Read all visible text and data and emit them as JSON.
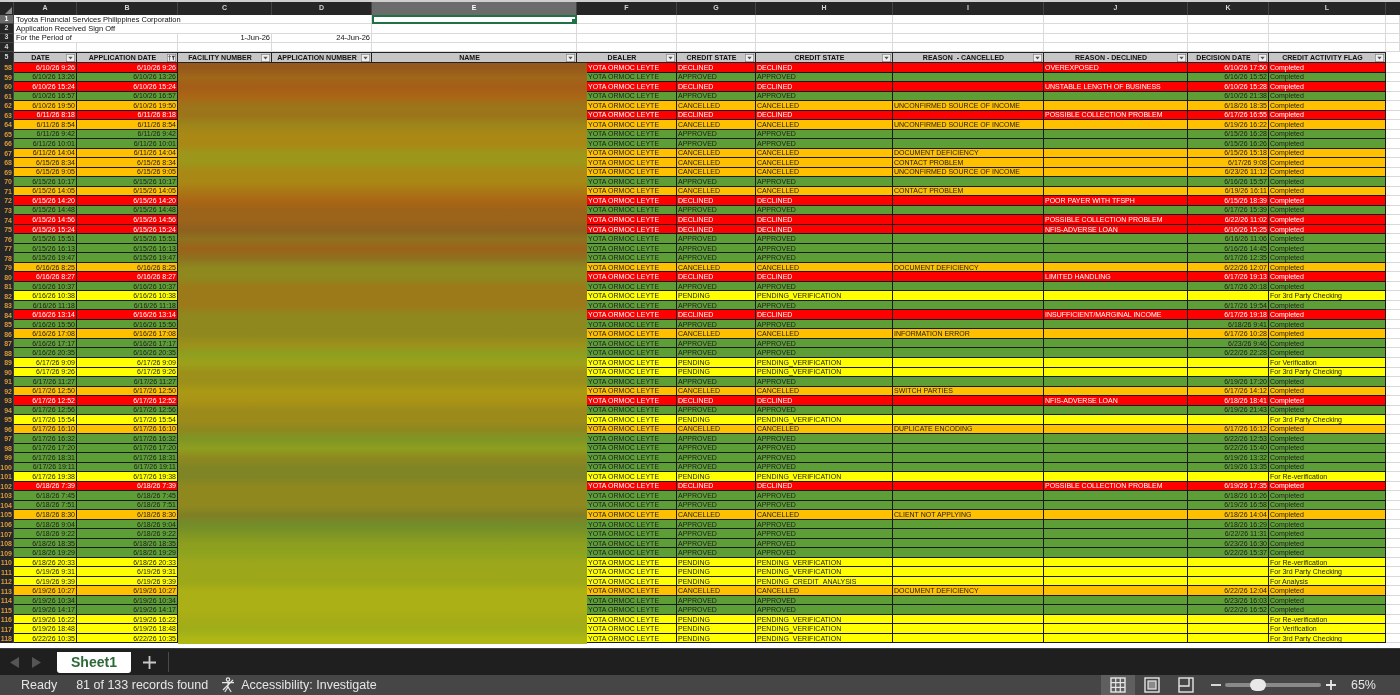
{
  "sheet": {
    "column_letters": [
      {
        "letter": "A",
        "selected": false
      },
      {
        "letter": "B",
        "selected": false
      },
      {
        "letter": "C",
        "selected": false
      },
      {
        "letter": "D",
        "selected": false
      },
      {
        "letter": "E",
        "selected": true
      },
      {
        "letter": "F",
        "selected": false
      },
      {
        "letter": "G",
        "selected": false
      },
      {
        "letter": "H",
        "selected": false
      },
      {
        "letter": "I",
        "selected": false
      },
      {
        "letter": "J",
        "selected": false
      },
      {
        "letter": "K",
        "selected": false
      },
      {
        "letter": "L",
        "selected": false
      }
    ],
    "title_rows": [
      {
        "row_number": "1",
        "selected": true,
        "a": "Toyota Financial Services Philippines Corporation"
      },
      {
        "row_number": "2",
        "selected": false,
        "a": "Application Received Sign Off"
      },
      {
        "row_number": "3",
        "selected": false,
        "a": "For the Period of",
        "c": "1-Jun-26",
        "d": "24-Jun-26"
      },
      {
        "row_number": "4",
        "selected": false
      }
    ],
    "header_row": {
      "row_number": "5",
      "columns": [
        {
          "label": "DATE",
          "kind": "dropdown"
        },
        {
          "label": "APPLICATION DATE",
          "kind": "sort_filter"
        },
        {
          "label": "FACILITY NUMBER",
          "kind": "dropdown"
        },
        {
          "label": "APPLICATION NUMBER",
          "kind": "dropdown"
        },
        {
          "label": "NAME",
          "kind": "dropdown"
        },
        {
          "label": "DEALER",
          "kind": "dropdown"
        },
        {
          "label": "CREDIT STATE",
          "kind": "dropdown"
        },
        {
          "label": "CREDIT STATE",
          "kind": "dropdown"
        },
        {
          "label": "REASON  - CANCELLED",
          "kind": "dropdown"
        },
        {
          "label": "REASON - DECLINED",
          "kind": "dropdown"
        },
        {
          "label": "DECISION DATE",
          "kind": "dropdown"
        },
        {
          "label": "CREDIT ACTIVITY FLAG",
          "kind": "dropdown"
        }
      ]
    },
    "rows": [
      {
        "row_number": "58",
        "date": "6/10/26 9:26",
        "application_date": "6/10/26 9:26",
        "dealer": "YOTA ORMOC LEYTE",
        "credit_state": "DECLINED",
        "credit_state_detail": "DECLINED",
        "reason_declined": "OVEREXPOSED",
        "decision_date": "6/10/26 17:50",
        "credit_activity_flag": "Completed",
        "color": "#ff0000"
      },
      {
        "row_number": "59",
        "date": "6/10/26 13:26",
        "application_date": "6/10/26 13:26",
        "dealer": "YOTA ORMOC LEYTE",
        "credit_state": "APPROVED",
        "credit_state_detail": "APPROVED",
        "decision_date": "6/16/26 15:52",
        "credit_activity_flag": "Completed",
        "color": "#5e9e37"
      },
      {
        "row_number": "60",
        "date": "6/10/26 15:24",
        "application_date": "6/10/26 15:24",
        "dealer": "YOTA ORMOC LEYTE",
        "credit_state": "DECLINED",
        "credit_state_detail": "DECLINED",
        "reason_declined": "UNSTABLE LENGTH OF BUSINESS",
        "decision_date": "6/10/26 15:28",
        "credit_activity_flag": "Completed",
        "color": "#ff0000"
      },
      {
        "row_number": "61",
        "date": "6/10/26 16:57",
        "application_date": "6/10/26 16:57",
        "dealer": "YOTA ORMOC LEYTE",
        "credit_state": "APPROVED",
        "credit_state_detail": "APPROVED",
        "decision_date": "6/10/26 21:38",
        "credit_activity_flag": "Completed",
        "color": "#5e9e37"
      },
      {
        "row_number": "62",
        "date": "6/10/26 19:50",
        "application_date": "6/10/26 19:50",
        "dealer": "YOTA ORMOC LEYTE",
        "credit_state": "CANCELLED",
        "credit_state_detail": "CANCELLED",
        "reason_cancelled": "UNCONFIRMED SOURCE OF INCOME",
        "decision_date": "6/18/26 18:35",
        "credit_activity_flag": "Completed",
        "color": "#ffc000"
      },
      {
        "row_number": "63",
        "date": "6/11/26 8:18",
        "application_date": "6/11/26 8:18",
        "dealer": "YOTA ORMOC LEYTE",
        "credit_state": "DECLINED",
        "credit_state_detail": "DECLINED",
        "reason_declined": "POSSIBLE COLLECTION PROBLEM",
        "decision_date": "6/17/26 16:55",
        "credit_activity_flag": "Completed",
        "color": "#ff0000"
      },
      {
        "row_number": "64",
        "date": "6/11/26 8:54",
        "application_date": "6/11/26 8:54",
        "dealer": "YOTA ORMOC LEYTE",
        "credit_state": "CANCELLED",
        "credit_state_detail": "CANCELLED",
        "reason_cancelled": "UNCONFIRMED SOURCE OF INCOME",
        "decision_date": "6/19/26 16:22",
        "credit_activity_flag": "Completed",
        "color": "#ffc000"
      },
      {
        "row_number": "65",
        "date": "6/11/26 9:42",
        "application_date": "6/11/26 9:42",
        "dealer": "YOTA ORMOC LEYTE",
        "credit_state": "APPROVED",
        "credit_state_detail": "APPROVED",
        "decision_date": "6/15/26 16:28",
        "credit_activity_flag": "Completed",
        "color": "#5e9e37"
      },
      {
        "row_number": "66",
        "date": "6/11/26 10:01",
        "application_date": "6/11/26 10:01",
        "dealer": "YOTA ORMOC LEYTE",
        "credit_state": "APPROVED",
        "credit_state_detail": "APPROVED",
        "decision_date": "6/15/26 16:26",
        "credit_activity_flag": "Completed",
        "color": "#5e9e37"
      },
      {
        "row_number": "67",
        "date": "6/11/26 14:04",
        "application_date": "6/11/26 14:04",
        "dealer": "YOTA ORMOC LEYTE",
        "credit_state": "CANCELLED",
        "credit_state_detail": "CANCELLED",
        "reason_cancelled": "DOCUMENT DEFICIENCY",
        "decision_date": "6/15/26 15:18",
        "credit_activity_flag": "Completed",
        "color": "#ffc000"
      },
      {
        "row_number": "68",
        "date": "6/15/26 8:34",
        "application_date": "6/15/26 8:34",
        "dealer": "YOTA ORMOC LEYTE",
        "credit_state": "CANCELLED",
        "credit_state_detail": "CANCELLED",
        "reason_cancelled": "CONTACT PROBLEM",
        "decision_date": "6/17/26 9:08",
        "credit_activity_flag": "Completed",
        "color": "#ffc000"
      },
      {
        "row_number": "69",
        "date": "6/15/26 9:05",
        "application_date": "6/15/26 9:05",
        "dealer": "YOTA ORMOC LEYTE",
        "credit_state": "CANCELLED",
        "credit_state_detail": "CANCELLED",
        "reason_cancelled": "UNCONFIRMED SOURCE OF INCOME",
        "decision_date": "6/23/26 11:12",
        "credit_activity_flag": "Completed",
        "color": "#ffc000"
      },
      {
        "row_number": "70",
        "date": "6/15/26 10:17",
        "application_date": "6/15/26 10:17",
        "dealer": "YOTA ORMOC LEYTE",
        "credit_state": "APPROVED",
        "credit_state_detail": "APPROVED",
        "decision_date": "6/16/26 15:57",
        "credit_activity_flag": "Completed",
        "color": "#5e9e37"
      },
      {
        "row_number": "71",
        "date": "6/15/26 14:05",
        "application_date": "6/15/26 14:05",
        "dealer": "YOTA ORMOC LEYTE",
        "credit_state": "CANCELLED",
        "credit_state_detail": "CANCELLED",
        "reason_cancelled": "CONTACT PROBLEM",
        "decision_date": "6/19/26 16:11",
        "credit_activity_flag": "Completed",
        "color": "#ffc000"
      },
      {
        "row_number": "72",
        "date": "6/15/26 14:20",
        "application_date": "6/15/26 14:20",
        "dealer": "YOTA ORMOC LEYTE",
        "credit_state": "DECLINED",
        "credit_state_detail": "DECLINED",
        "reason_declined": "POOR PAYER WITH TFSPH",
        "decision_date": "6/15/26 18:39",
        "credit_activity_flag": "Completed",
        "color": "#ff0000"
      },
      {
        "row_number": "73",
        "date": "6/15/26 14:48",
        "application_date": "6/15/26 14:48",
        "dealer": "YOTA ORMOC LEYTE",
        "credit_state": "APPROVED",
        "credit_state_detail": "APPROVED",
        "decision_date": "6/17/26 15:39",
        "credit_activity_flag": "Completed",
        "color": "#5e9e37"
      },
      {
        "row_number": "74",
        "date": "6/15/26 14:56",
        "application_date": "6/15/26 14:56",
        "dealer": "YOTA ORMOC LEYTE",
        "credit_state": "DECLINED",
        "credit_state_detail": "DECLINED",
        "reason_declined": "POSSIBLE COLLECTION PROBLEM",
        "decision_date": "6/22/26 11:02",
        "credit_activity_flag": "Completed",
        "color": "#ff0000"
      },
      {
        "row_number": "75",
        "date": "6/15/26 15:24",
        "application_date": "6/15/26 15:24",
        "dealer": "YOTA ORMOC LEYTE",
        "credit_state": "DECLINED",
        "credit_state_detail": "DECLINED",
        "reason_declined": "NFIS-ADVERSE LOAN",
        "decision_date": "6/16/26 15:25",
        "credit_activity_flag": "Completed",
        "color": "#ff0000"
      },
      {
        "row_number": "76",
        "date": "6/15/26 15:51",
        "application_date": "6/15/26 15:51",
        "dealer": "YOTA ORMOC LEYTE",
        "credit_state": "APPROVED",
        "credit_state_detail": "APPROVED",
        "decision_date": "6/16/26 11:06",
        "credit_activity_flag": "Completed",
        "color": "#5e9e37"
      },
      {
        "row_number": "77",
        "date": "6/15/26 16:13",
        "application_date": "6/15/26 16:13",
        "dealer": "YOTA ORMOC LEYTE",
        "credit_state": "APPROVED",
        "credit_state_detail": "APPROVED",
        "decision_date": "6/16/26 14:45",
        "credit_activity_flag": "Completed",
        "color": "#5e9e37"
      },
      {
        "row_number": "78",
        "date": "6/15/26 19:47",
        "application_date": "6/15/26 19:47",
        "dealer": "YOTA ORMOC LEYTE",
        "credit_state": "APPROVED",
        "credit_state_detail": "APPROVED",
        "decision_date": "6/17/26 12:35",
        "credit_activity_flag": "Completed",
        "color": "#5e9e37"
      },
      {
        "row_number": "79",
        "date": "6/16/26 8:25",
        "application_date": "6/16/26 8:25",
        "dealer": "YOTA ORMOC LEYTE",
        "credit_state": "CANCELLED",
        "credit_state_detail": "CANCELLED",
        "reason_cancelled": "DOCUMENT DEFICIENCY",
        "decision_date": "6/22/26 12:07",
        "credit_activity_flag": "Completed",
        "color": "#ffc000"
      },
      {
        "row_number": "80",
        "date": "6/16/26 8:27",
        "application_date": "6/16/26 8:27",
        "dealer": "YOTA ORMOC LEYTE",
        "credit_state": "DECLINED",
        "credit_state_detail": "DECLINED",
        "reason_declined": "LIMITED HANDLING",
        "decision_date": "6/17/26 19:13",
        "credit_activity_flag": "Completed",
        "color": "#ff0000"
      },
      {
        "row_number": "81",
        "date": "6/16/26 10:37",
        "application_date": "6/16/26 10:37",
        "dealer": "YOTA ORMOC LEYTE",
        "credit_state": "APPROVED",
        "credit_state_detail": "APPROVED",
        "decision_date": "6/17/26 20:18",
        "credit_activity_flag": "Completed",
        "color": "#5e9e37"
      },
      {
        "row_number": "82",
        "date": "6/16/26 10:38",
        "application_date": "6/16/26 10:38",
        "dealer": "YOTA ORMOC LEYTE",
        "credit_state": "PENDING",
        "credit_state_detail": "PENDING_VERIFICATION",
        "credit_activity_flag": "For 3rd Party Checking",
        "color": "#ffff00"
      },
      {
        "row_number": "83",
        "date": "6/16/26 11:18",
        "application_date": "6/16/26 11:18",
        "dealer": "YOTA ORMOC LEYTE",
        "credit_state": "APPROVED",
        "credit_state_detail": "APPROVED",
        "decision_date": "6/17/26 19:54",
        "credit_activity_flag": "Completed",
        "color": "#5e9e37"
      },
      {
        "row_number": "84",
        "date": "6/16/26 13:14",
        "application_date": "6/16/26 13:14",
        "dealer": "YOTA ORMOC LEYTE",
        "credit_state": "DECLINED",
        "credit_state_detail": "DECLINED",
        "reason_declined": "INSUFFICIENT/MARGINAL INCOME",
        "decision_date": "6/17/26 19:18",
        "credit_activity_flag": "Completed",
        "color": "#ff0000"
      },
      {
        "row_number": "85",
        "date": "6/16/26 15:50",
        "application_date": "6/16/26 15:50",
        "dealer": "YOTA ORMOC LEYTE",
        "credit_state": "APPROVED",
        "credit_state_detail": "APPROVED",
        "decision_date": "6/18/26 9:41",
        "credit_activity_flag": "Completed",
        "color": "#5e9e37"
      },
      {
        "row_number": "86",
        "date": "6/16/26 17:08",
        "application_date": "6/16/26 17:08",
        "dealer": "YOTA ORMOC LEYTE",
        "credit_state": "CANCELLED",
        "credit_state_detail": "CANCELLED",
        "reason_cancelled": "INFORMATION ERROR",
        "decision_date": "6/17/26 10:28",
        "credit_activity_flag": "Completed",
        "color": "#ffc000"
      },
      {
        "row_number": "87",
        "date": "6/16/26 17:17",
        "application_date": "6/16/26 17:17",
        "dealer": "YOTA ORMOC LEYTE",
        "credit_state": "APPROVED",
        "credit_state_detail": "APPROVED",
        "decision_date": "6/23/26 9:46",
        "credit_activity_flag": "Completed",
        "color": "#5e9e37"
      },
      {
        "row_number": "88",
        "date": "6/16/26 20:35",
        "application_date": "6/16/26 20:35",
        "dealer": "YOTA ORMOC LEYTE",
        "credit_state": "APPROVED",
        "credit_state_detail": "APPROVED",
        "decision_date": "6/22/26 22:28",
        "credit_activity_flag": "Completed",
        "color": "#5e9e37"
      },
      {
        "row_number": "89",
        "date": "6/17/26 9:09",
        "application_date": "6/17/26 9:09",
        "dealer": "YOTA ORMOC LEYTE",
        "credit_state": "PENDING",
        "credit_state_detail": "PENDING_VERIFICATION",
        "credit_activity_flag": "For Verification",
        "color": "#ffff00"
      },
      {
        "row_number": "90",
        "date": "6/17/26 9:26",
        "application_date": "6/17/26 9:26",
        "dealer": "YOTA ORMOC LEYTE",
        "credit_state": "PENDING",
        "credit_state_detail": "PENDING_VERIFICATION",
        "credit_activity_flag": "For 3rd Party Checking",
        "color": "#ffff00"
      },
      {
        "row_number": "91",
        "date": "6/17/26 11:27",
        "application_date": "6/17/26 11:27",
        "dealer": "YOTA ORMOC LEYTE",
        "credit_state": "APPROVED",
        "credit_state_detail": "APPROVED",
        "decision_date": "6/19/26 17:20",
        "credit_activity_flag": "Completed",
        "color": "#5e9e37"
      },
      {
        "row_number": "92",
        "date": "6/17/26 12:50",
        "application_date": "6/17/26 12:50",
        "dealer": "YOTA ORMOC LEYTE",
        "credit_state": "CANCELLED",
        "credit_state_detail": "CANCELLED",
        "reason_cancelled": "SWITCH PARTIES",
        "decision_date": "6/17/26 14:12",
        "credit_activity_flag": "Completed",
        "color": "#ffc000"
      },
      {
        "row_number": "93",
        "date": "6/17/26 12:52",
        "application_date": "6/17/26 12:52",
        "dealer": "YOTA ORMOC LEYTE",
        "credit_state": "DECLINED",
        "credit_state_detail": "DECLINED",
        "reason_declined": "NFIS-ADVERSE LOAN",
        "decision_date": "6/18/26 18:41",
        "credit_activity_flag": "Completed",
        "color": "#ff0000"
      },
      {
        "row_number": "94",
        "date": "6/17/26 12:56",
        "application_date": "6/17/26 12:56",
        "dealer": "YOTA ORMOC LEYTE",
        "credit_state": "APPROVED",
        "credit_state_detail": "APPROVED",
        "decision_date": "6/19/26 21:43",
        "credit_activity_flag": "Completed",
        "color": "#5e9e37"
      },
      {
        "row_number": "95",
        "date": "6/17/26 15:54",
        "application_date": "6/17/26 15:54",
        "dealer": "YOTA ORMOC LEYTE",
        "credit_state": "PENDING",
        "credit_state_detail": "PENDING_VERIFICATION",
        "credit_activity_flag": "For 3rd Party Checking",
        "color": "#ffff00"
      },
      {
        "row_number": "96",
        "date": "6/17/26 16:10",
        "application_date": "6/17/26 16:10",
        "dealer": "YOTA ORMOC LEYTE",
        "credit_state": "CANCELLED",
        "credit_state_detail": "CANCELLED",
        "reason_cancelled": "DUPLICATE ENCODING",
        "decision_date": "6/17/26 16:12",
        "credit_activity_flag": "Completed",
        "color": "#ffc000"
      },
      {
        "row_number": "97",
        "date": "6/17/26 16:32",
        "application_date": "6/17/26 16:32",
        "dealer": "YOTA ORMOC LEYTE",
        "credit_state": "APPROVED",
        "credit_state_detail": "APPROVED",
        "decision_date": "6/22/26 12:53",
        "credit_activity_flag": "Completed",
        "color": "#5e9e37"
      },
      {
        "row_number": "98",
        "date": "6/17/26 17:20",
        "application_date": "6/17/26 17:20",
        "dealer": "YOTA ORMOC LEYTE",
        "credit_state": "APPROVED",
        "credit_state_detail": "APPROVED",
        "decision_date": "6/22/26 15:40",
        "credit_activity_flag": "Completed",
        "color": "#5e9e37"
      },
      {
        "row_number": "99",
        "date": "6/17/26 18:31",
        "application_date": "6/17/26 18:31",
        "dealer": "YOTA ORMOC LEYTE",
        "credit_state": "APPROVED",
        "credit_state_detail": "APPROVED",
        "decision_date": "6/19/26 13:32",
        "credit_activity_flag": "Completed",
        "color": "#5e9e37"
      },
      {
        "row_number": "100",
        "date": "6/17/26 19:11",
        "application_date": "6/17/26 19:11",
        "dealer": "YOTA ORMOC LEYTE",
        "credit_state": "APPROVED",
        "credit_state_detail": "APPROVED",
        "decision_date": "6/19/26 13:35",
        "credit_activity_flag": "Completed",
        "color": "#5e9e37"
      },
      {
        "row_number": "101",
        "date": "6/17/26 19:38",
        "application_date": "6/17/26 19:38",
        "dealer": "YOTA ORMOC LEYTE",
        "credit_state": "PENDING",
        "credit_state_detail": "PENDING_VERIFICATION",
        "credit_activity_flag": "For Re-verification",
        "color": "#ffff00"
      },
      {
        "row_number": "102",
        "date": "6/18/26 7:39",
        "application_date": "6/18/26 7:39",
        "dealer": "YOTA ORMOC LEYTE",
        "credit_state": "DECLINED",
        "credit_state_detail": "DECLINED",
        "reason_declined": "POSSIBLE COLLECTION PROBLEM",
        "decision_date": "6/19/26 17:35",
        "credit_activity_flag": "Completed",
        "color": "#ff0000"
      },
      {
        "row_number": "103",
        "date": "6/18/26 7:45",
        "application_date": "6/18/26 7:45",
        "dealer": "YOTA ORMOC LEYTE",
        "credit_state": "APPROVED",
        "credit_state_detail": "APPROVED",
        "decision_date": "6/18/26 16:26",
        "credit_activity_flag": "Completed",
        "color": "#5e9e37"
      },
      {
        "row_number": "104",
        "date": "6/18/26 7:51",
        "application_date": "6/18/26 7:51",
        "dealer": "YOTA ORMOC LEYTE",
        "credit_state": "APPROVED",
        "credit_state_detail": "APPROVED",
        "decision_date": "6/19/26 16:58",
        "credit_activity_flag": "Completed",
        "color": "#5e9e37"
      },
      {
        "row_number": "105",
        "date": "6/18/26 8:30",
        "application_date": "6/18/26 8:30",
        "dealer": "YOTA ORMOC LEYTE",
        "credit_state": "CANCELLED",
        "credit_state_detail": "CANCELLED",
        "reason_cancelled": "CLIENT NOT APPLYING",
        "decision_date": "6/18/26 14:04",
        "credit_activity_flag": "Completed",
        "color": "#ffc000"
      },
      {
        "row_number": "106",
        "date": "6/18/26 9:04",
        "application_date": "6/18/26 9:04",
        "dealer": "YOTA ORMOC LEYTE",
        "credit_state": "APPROVED",
        "credit_state_detail": "APPROVED",
        "decision_date": "6/18/26 16:29",
        "credit_activity_flag": "Completed",
        "color": "#5e9e37"
      },
      {
        "row_number": "107",
        "date": "6/18/26 9:22",
        "application_date": "6/18/26 9:22",
        "dealer": "YOTA ORMOC LEYTE",
        "credit_state": "APPROVED",
        "credit_state_detail": "APPROVED",
        "decision_date": "6/22/26 11:31",
        "credit_activity_flag": "Completed",
        "color": "#5e9e37"
      },
      {
        "row_number": "108",
        "date": "6/18/26 18:35",
        "application_date": "6/18/26 18:35",
        "dealer": "YOTA ORMOC LEYTE",
        "credit_state": "APPROVED",
        "credit_state_detail": "APPROVED",
        "decision_date": "6/23/26 16:30",
        "credit_activity_flag": "Completed",
        "color": "#5e9e37"
      },
      {
        "row_number": "109",
        "date": "6/18/26 19:29",
        "application_date": "6/18/26 19:29",
        "dealer": "YOTA ORMOC LEYTE",
        "credit_state": "APPROVED",
        "credit_state_detail": "APPROVED",
        "decision_date": "6/22/26 15:37",
        "credit_activity_flag": "Completed",
        "color": "#5e9e37"
      },
      {
        "row_number": "110",
        "date": "6/18/26 20:33",
        "application_date": "6/18/26 20:33",
        "dealer": "YOTA ORMOC LEYTE",
        "credit_state": "PENDING",
        "credit_state_detail": "PENDING_VERIFICATION",
        "credit_activity_flag": "For Re-verification",
        "color": "#ffff00"
      },
      {
        "row_number": "111",
        "date": "6/19/26 9:31",
        "application_date": "6/19/26 9:31",
        "dealer": "YOTA ORMOC LEYTE",
        "credit_state": "PENDING",
        "credit_state_detail": "PENDING_VERIFICATION",
        "credit_activity_flag": "For 3rd Party Checking",
        "color": "#ffff00"
      },
      {
        "row_number": "112",
        "date": "6/19/26 9:39",
        "application_date": "6/19/26 9:39",
        "dealer": "YOTA ORMOC LEYTE",
        "credit_state": "PENDING",
        "credit_state_detail": "PENDING_CREDIT_ANALYSIS",
        "credit_activity_flag": "For Analysis",
        "color": "#ffff00"
      },
      {
        "row_number": "113",
        "date": "6/19/26 10:27",
        "application_date": "6/19/26 10:27",
        "dealer": "YOTA ORMOC LEYTE",
        "credit_state": "CANCELLED",
        "credit_state_detail": "CANCELLED",
        "reason_cancelled": "DOCUMENT DEFICIENCY",
        "decision_date": "6/22/26 12:04",
        "credit_activity_flag": "Completed",
        "color": "#ffc000"
      },
      {
        "row_number": "114",
        "date": "6/19/26 10:34",
        "application_date": "6/19/26 10:34",
        "dealer": "YOTA ORMOC LEYTE",
        "credit_state": "APPROVED",
        "credit_state_detail": "APPROVED",
        "decision_date": "6/23/26 16:03",
        "credit_activity_flag": "Completed",
        "color": "#5e9e37"
      },
      {
        "row_number": "115",
        "date": "6/19/26 14:17",
        "application_date": "6/19/26 14:17",
        "dealer": "YOTA ORMOC LEYTE",
        "credit_state": "APPROVED",
        "credit_state_detail": "APPROVED",
        "decision_date": "6/22/26 16:52",
        "credit_activity_flag": "Completed",
        "color": "#5e9e37"
      },
      {
        "row_number": "116",
        "date": "6/19/26 16:22",
        "application_date": "6/19/26 16:22",
        "dealer": "YOTA ORMOC LEYTE",
        "credit_state": "PENDING",
        "credit_state_detail": "PENDING_VERIFICATION",
        "credit_activity_flag": "For Re-verification",
        "color": "#ffff00"
      },
      {
        "row_number": "117",
        "date": "6/19/26 18:48",
        "application_date": "6/19/26 18:48",
        "dealer": "YOTA ORMOC LEYTE",
        "credit_state": "PENDING",
        "credit_state_detail": "PENDING_VERIFICATION",
        "credit_activity_flag": "For Verification",
        "color": "#ffff00"
      },
      {
        "row_number": "118",
        "date": "6/22/26 10:35",
        "application_date": "6/22/26 10:35",
        "dealer": "YOTA ORMOC LEYTE",
        "credit_state": "PENDING",
        "credit_state_detail": "PENDING_VERIFICATION",
        "credit_activity_flag": "For 3rd Party Checking",
        "color": "#ffff00"
      }
    ]
  },
  "sheet_tabs": {
    "tabs": [
      {
        "label": "Sheet1",
        "selected": true
      }
    ]
  },
  "status_bar": {
    "mode": "Ready",
    "records": "81 of 133 records found",
    "accessibility": "Accessibility: Investigate",
    "views": [
      {
        "kind": "normal",
        "selected": true
      },
      {
        "kind": "page_layout",
        "selected": false
      },
      {
        "kind": "page_break",
        "selected": false
      }
    ],
    "zoom": {
      "level": 0.34,
      "reading": "65%"
    }
  }
}
